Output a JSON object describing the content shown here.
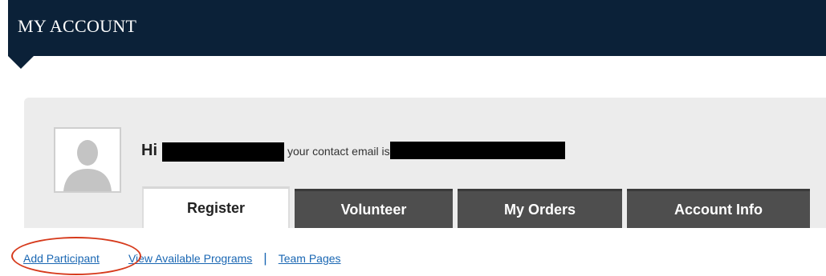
{
  "header": {
    "title": "MY ACCOUNT"
  },
  "profile": {
    "avatar_icon": "user-silhouette-icon",
    "greeting_prefix": "Hi",
    "contact_text": "your contact email is"
  },
  "tabs": [
    {
      "label": "Register",
      "active": true
    },
    {
      "label": "Volunteer",
      "active": false
    },
    {
      "label": "My Orders",
      "active": false
    },
    {
      "label": "Account Info",
      "active": false
    }
  ],
  "links": {
    "add_participant": "Add Participant",
    "view_programs": "View Available Programs",
    "separator": "|",
    "team_pages": "Team Pages"
  },
  "colors": {
    "banner": "#0b2138",
    "panel": "#ececec",
    "tab_dark": "#4e4e4e",
    "link": "#1a67b3",
    "annotation": "#d63a1c"
  }
}
